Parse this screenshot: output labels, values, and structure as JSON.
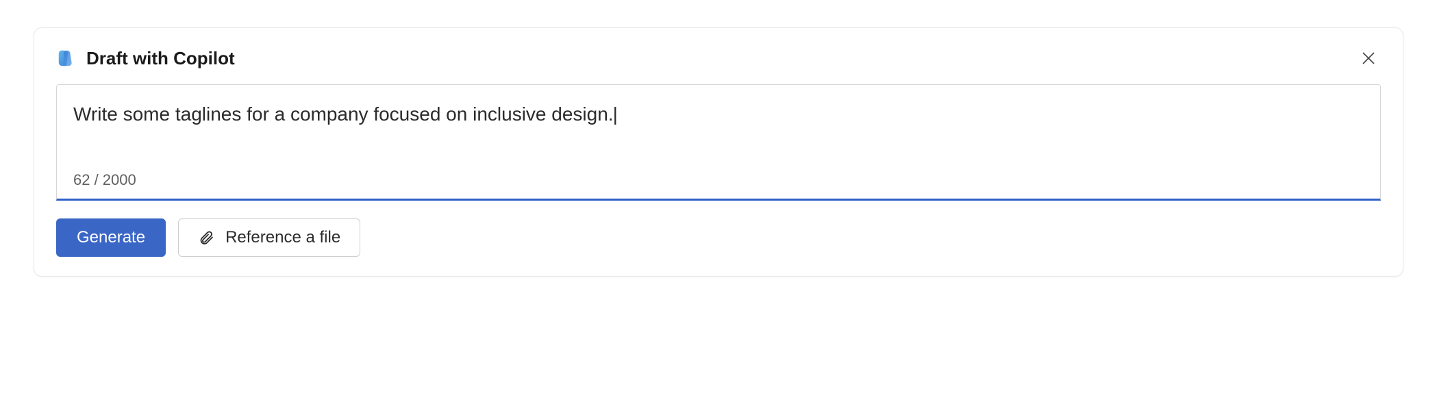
{
  "header": {
    "title": "Draft with Copilot"
  },
  "input": {
    "prompt_value": "Write some taglines for a company focused on inclusive design.",
    "char_count": "62 / 2000"
  },
  "actions": {
    "generate_label": "Generate",
    "reference_label": "Reference a file"
  }
}
